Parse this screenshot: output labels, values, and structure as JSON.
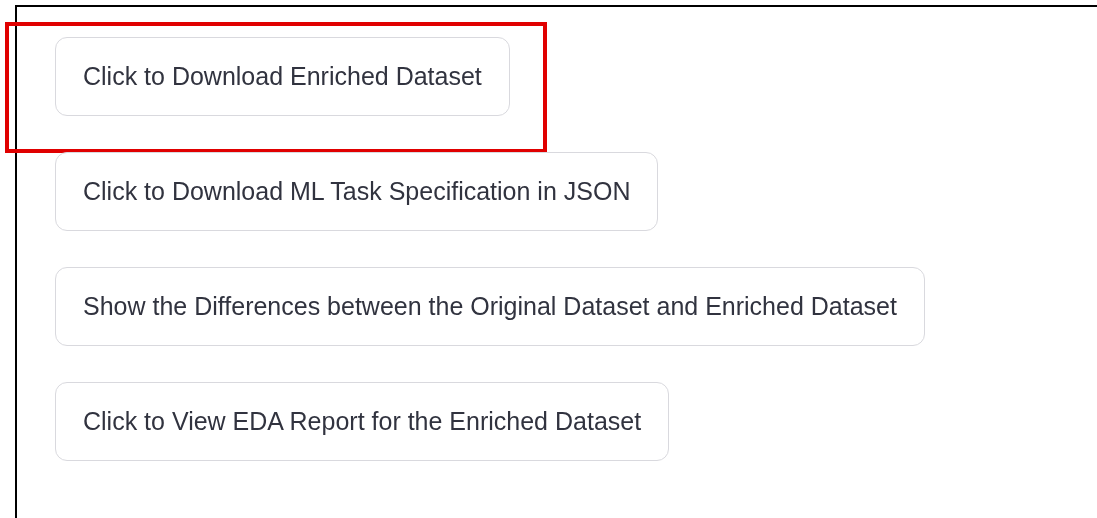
{
  "buttons": [
    {
      "label": "Click to Download Enriched Dataset",
      "highlighted": true
    },
    {
      "label": "Click to Download ML Task Specification in JSON",
      "highlighted": false
    },
    {
      "label": "Show the Differences between the Original Dataset and Enriched Dataset",
      "highlighted": false
    },
    {
      "label": "Click to View EDA Report for the Enriched Dataset",
      "highlighted": false
    }
  ]
}
